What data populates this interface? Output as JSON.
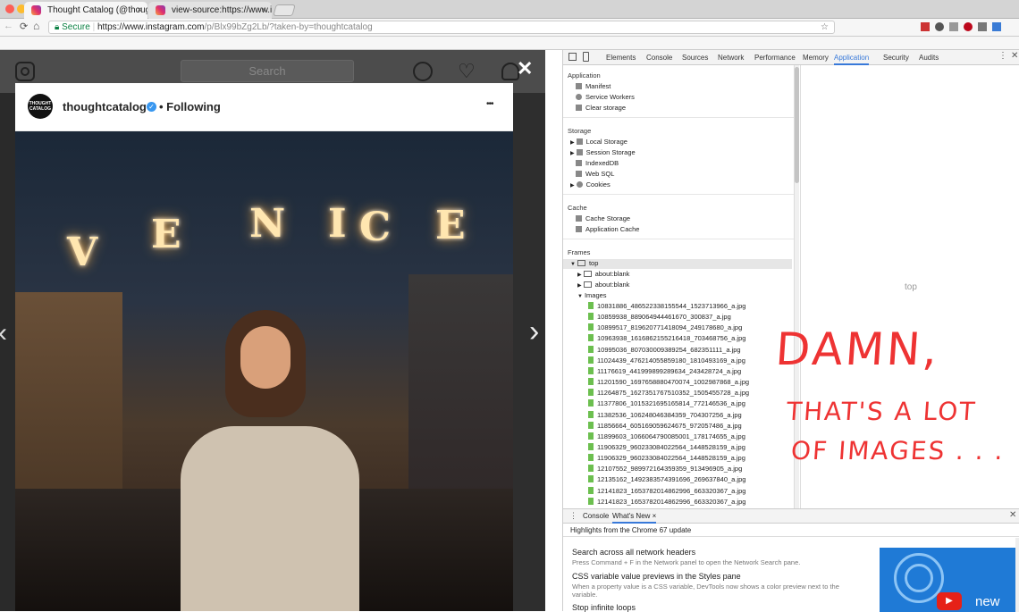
{
  "browser": {
    "tabs": [
      {
        "title": "Thought Catalog (@thoughtca",
        "close": "×"
      },
      {
        "title": "view-source:https://www.insta",
        "close": "×"
      }
    ],
    "nav_back": "←",
    "nav_forward": "→",
    "reload": "⟳",
    "home": "⌂",
    "secure_label": "Secure",
    "url_host": "https://www.instagram.com",
    "url_path": "/p/Blx99bZg2Lb/?taken-by=thoughtcatalog",
    "star": "☆"
  },
  "instagram": {
    "search_placeholder": "Search",
    "username": "thoughtcatalog",
    "avatar_text": "THOUGHT CATALOG",
    "follow_status": "• Following",
    "more": "•••",
    "close": "✕",
    "next_arrow": "›",
    "prev_arrow": "‹",
    "photo_text": [
      "V",
      "E",
      "N",
      "I",
      "C",
      "E"
    ]
  },
  "devtools": {
    "tabs": [
      "Elements",
      "Console",
      "Sources",
      "Network",
      "Performance",
      "Memory",
      "Application",
      "Security",
      "Audits"
    ],
    "active_tab": "Application",
    "sections": {
      "application": {
        "title": "Application",
        "items": [
          "Manifest",
          "Service Workers",
          "Clear storage"
        ]
      },
      "storage": {
        "title": "Storage",
        "items": [
          "Local Storage",
          "Session Storage",
          "IndexedDB",
          "Web SQL",
          "Cookies"
        ]
      },
      "cache": {
        "title": "Cache",
        "items": [
          "Cache Storage",
          "Application Cache"
        ]
      },
      "frames": {
        "title": "Frames",
        "top": "top",
        "children": [
          "about:blank",
          "about:blank"
        ],
        "images_label": "Images"
      }
    },
    "images": [
      "10831886_486522338155544_1523713966_a.jpg",
      "10859938_889064944461670_300837_a.jpg",
      "10899517_819620771418094_249178680_a.jpg",
      "10963938_1616862155216418_703468756_a.jpg",
      "10995036_807030009389254_682351111_a.jpg",
      "11024439_476214055859180_1810493169_a.jpg",
      "11176619_441999899289634_243428724_a.jpg",
      "11201590_1697658880470074_1002987868_a.jpg",
      "11264875_1627351767510352_1505455728_a.jpg",
      "11377806_1015321695165814_772146536_a.jpg",
      "11382536_1062480463843​59_704307256_a.jpg",
      "11856664_605169059624675_972057486_a.jpg",
      "11899603_1066064790085001_178174655_a.jpg",
      "11906329_960233084022564_1448528159_a.jpg",
      "11906329_960233084022564_1448528159_a.jpg",
      "12107552_989972164359359_913496905_a.jpg",
      "12135162_1492383574391696_269637840_a.jpg",
      "12141823_1653782014862996_663320367_a.jpg",
      "12141823_1653782014862996_663320367_a.jpg"
    ],
    "preview_label": "top",
    "annotation": {
      "line1": "DAMN,",
      "line2": "THAT'S A LOT",
      "line3": "OF IMAGES . . ."
    },
    "drawer": {
      "tabs": [
        "Console",
        "What's New"
      ],
      "close": "×",
      "highlights": "Highlights from the Chrome 67 update",
      "entries": [
        {
          "title": "Search across all network headers",
          "desc": "Press Command + F in the Network panel to open the Network Search pane."
        },
        {
          "title": "CSS variable value previews in the Styles pane",
          "desc": "When a property value is a CSS variable, DevTools now shows a color preview next to the variable."
        },
        {
          "title": "Stop infinite loops",
          "desc": ""
        }
      ],
      "video_label": "new"
    }
  }
}
